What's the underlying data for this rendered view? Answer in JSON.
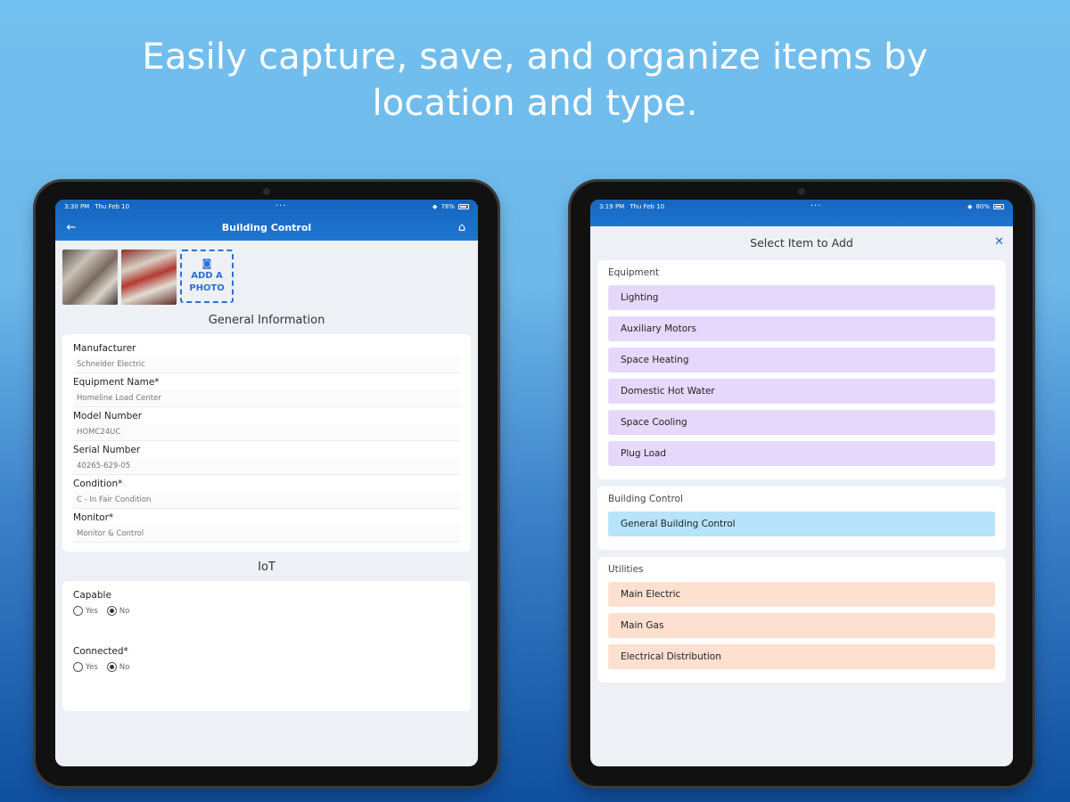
{
  "headline": {
    "line1": "Easily capture, save, and organize items by",
    "line2": "location and type."
  },
  "left_screen": {
    "status": {
      "time": "3:30 PM",
      "date": "Thu Feb 10",
      "battery": "78%"
    },
    "nav": {
      "title": "Building Control",
      "back_icon": "arrow-left-icon",
      "home_icon": "home-icon"
    },
    "add_photo": {
      "line1": "ADD A",
      "line2": "PHOTO"
    },
    "general_title": "General Information",
    "fields": [
      {
        "label": "Manufacturer",
        "value": "Schneider Electric"
      },
      {
        "label": "Equipment Name*",
        "value": "Homeline Load Center"
      },
      {
        "label": "Model Number",
        "value": "HOMC24UC"
      },
      {
        "label": "Serial Number",
        "value": "40265-629-05"
      },
      {
        "label": "Condition*",
        "value": "C - In Fair Condition"
      },
      {
        "label": "Monitor*",
        "value": "Monitor & Control"
      }
    ],
    "iot_title": "IoT",
    "capable": {
      "label": "Capable",
      "yes": "Yes",
      "no": "No",
      "selected": "No"
    },
    "connected": {
      "label": "Connected*",
      "yes": "Yes",
      "no": "No",
      "selected": "No"
    }
  },
  "right_screen": {
    "status": {
      "time": "3:19 PM",
      "date": "Thu Feb 10",
      "battery": "80%"
    },
    "modal_title": "Select Item to Add",
    "groups": [
      {
        "title": "Equipment",
        "color": "#e6d8fb",
        "items": [
          "Lighting",
          "Auxiliary Motors",
          "Space Heating",
          "Domestic Hot Water",
          "Space Cooling",
          "Plug Load"
        ]
      },
      {
        "title": "Building Control",
        "color": "#b7e4fb",
        "items": [
          "General Building Control"
        ]
      },
      {
        "title": "Utilities",
        "color": "#fde0d0",
        "items": [
          "Main Electric",
          "Main Gas",
          "Electrical Distribution"
        ]
      }
    ]
  }
}
